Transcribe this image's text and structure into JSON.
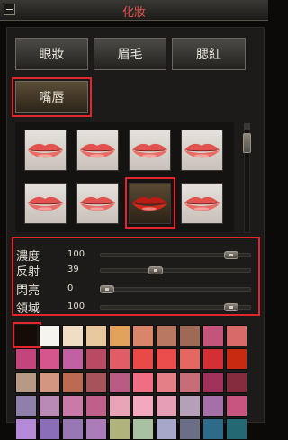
{
  "window": {
    "title": "化妝"
  },
  "tabs": [
    {
      "label": "眼妝"
    },
    {
      "label": "眉毛"
    },
    {
      "label": "腮紅"
    },
    {
      "label": "嘴唇",
      "active": true
    }
  ],
  "lip_styles": {
    "count": 8,
    "selected_index": 6,
    "icon_name": "lip-style-icon"
  },
  "sliders": [
    {
      "label": "濃度",
      "value": "100",
      "level": 1.0
    },
    {
      "label": "反射",
      "value": "39",
      "level": 0.39
    },
    {
      "label": "閃亮",
      "value": "0",
      "level": 0.0
    },
    {
      "label": "領域",
      "value": "100",
      "level": 1.0
    }
  ],
  "palette": {
    "selected_index": 0,
    "colors": [
      "#150c06",
      "#f6f4ef",
      "#f1ddc4",
      "#e7c79b",
      "#e2a25e",
      "#d9856a",
      "#b97862",
      "#9f6a55",
      "#c3547c",
      "#d86a6a",
      "#c2457c",
      "#d4568d",
      "#c05fa4",
      "#b84a63",
      "#e05d68",
      "#e94a47",
      "#ea4b4b",
      "#e56762",
      "#d52f36",
      "#c72a10",
      "#b79a86",
      "#d39781",
      "#bc6b52",
      "#a6545a",
      "#ba5b83",
      "#f06d84",
      "#e47e87",
      "#c56e77",
      "#a0315d",
      "#852c3e",
      "#8f80ab",
      "#b98ab4",
      "#c97aa8",
      "#bf608a",
      "#e8a3b6",
      "#f2a8bd",
      "#e59eb6",
      "#b69fb8",
      "#a56fa7",
      "#c7557f",
      "#b48ad8",
      "#8a6fb8",
      "#9877b2",
      "#ac7cb8",
      "#b1b37d",
      "#a9c0a3",
      "#a6a7c9",
      "#6a6e87",
      "#2d6b89",
      "#246873"
    ]
  }
}
